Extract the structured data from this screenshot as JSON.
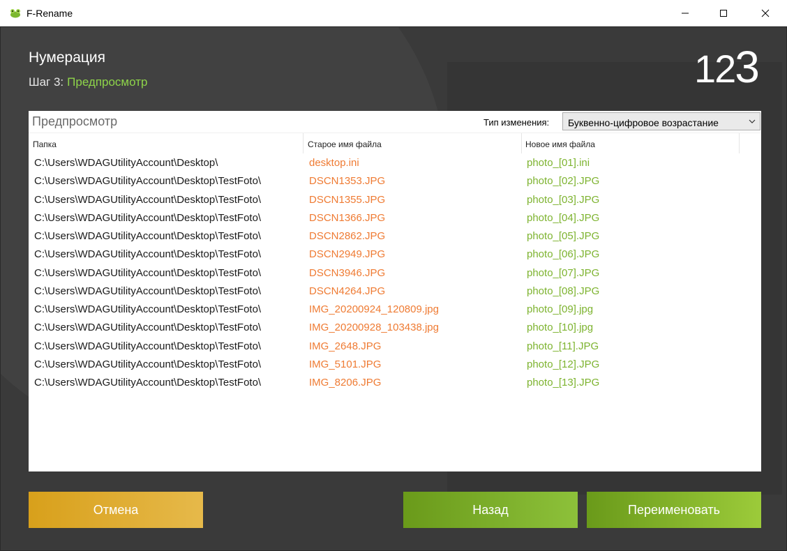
{
  "window": {
    "title": "F-Rename"
  },
  "header": {
    "title": "Нумерация",
    "step_label": "Шаг 3:",
    "step_name": "Предпросмотр",
    "logo_small": "12",
    "logo_big": "3"
  },
  "preview": {
    "title": "Предпросмотр",
    "change_type_label": "Тип изменения:",
    "change_type_value": "Буквенно-цифровое возрастание",
    "columns": [
      "Папка",
      "Старое имя файла",
      "Новое имя файла"
    ],
    "rows": [
      {
        "folder": "C:\\Users\\WDAGUtilityAccount\\Desktop\\",
        "old": "desktop.ini",
        "new": "photo_[01].ini"
      },
      {
        "folder": "C:\\Users\\WDAGUtilityAccount\\Desktop\\TestFoto\\",
        "old": "DSCN1353.JPG",
        "new": "photo_[02].JPG"
      },
      {
        "folder": "C:\\Users\\WDAGUtilityAccount\\Desktop\\TestFoto\\",
        "old": "DSCN1355.JPG",
        "new": "photo_[03].JPG"
      },
      {
        "folder": "C:\\Users\\WDAGUtilityAccount\\Desktop\\TestFoto\\",
        "old": "DSCN1366.JPG",
        "new": "photo_[04].JPG"
      },
      {
        "folder": "C:\\Users\\WDAGUtilityAccount\\Desktop\\TestFoto\\",
        "old": "DSCN2862.JPG",
        "new": "photo_[05].JPG"
      },
      {
        "folder": "C:\\Users\\WDAGUtilityAccount\\Desktop\\TestFoto\\",
        "old": "DSCN2949.JPG",
        "new": "photo_[06].JPG"
      },
      {
        "folder": "C:\\Users\\WDAGUtilityAccount\\Desktop\\TestFoto\\",
        "old": "DSCN3946.JPG",
        "new": "photo_[07].JPG"
      },
      {
        "folder": "C:\\Users\\WDAGUtilityAccount\\Desktop\\TestFoto\\",
        "old": "DSCN4264.JPG",
        "new": "photo_[08].JPG"
      },
      {
        "folder": "C:\\Users\\WDAGUtilityAccount\\Desktop\\TestFoto\\",
        "old": "IMG_20200924_120809.jpg",
        "new": "photo_[09].jpg"
      },
      {
        "folder": "C:\\Users\\WDAGUtilityAccount\\Desktop\\TestFoto\\",
        "old": "IMG_20200928_103438.jpg",
        "new": "photo_[10].jpg"
      },
      {
        "folder": "C:\\Users\\WDAGUtilityAccount\\Desktop\\TestFoto\\",
        "old": "IMG_2648.JPG",
        "new": "photo_[11].JPG"
      },
      {
        "folder": "C:\\Users\\WDAGUtilityAccount\\Desktop\\TestFoto\\",
        "old": "IMG_5101.JPG",
        "new": "photo_[12].JPG"
      },
      {
        "folder": "C:\\Users\\WDAGUtilityAccount\\Desktop\\TestFoto\\",
        "old": "IMG_8206.JPG",
        "new": "photo_[13].JPG"
      }
    ]
  },
  "buttons": {
    "cancel": "Отмена",
    "back": "Назад",
    "rename": "Переименовать"
  },
  "colors": {
    "old_name": "#ef7b33",
    "new_name": "#7db32f",
    "accent_green": "#8ed44a",
    "cancel_button": "#d8a01b"
  },
  "icons": {
    "app": "frog-app-icon",
    "minimize": "minimize-icon",
    "maximize": "maximize-icon",
    "close": "close-icon",
    "dropdown": "chevron-down-icon"
  }
}
